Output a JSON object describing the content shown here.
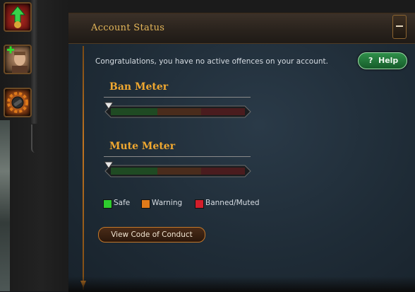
{
  "sidebar": {
    "buttons": [
      {
        "name": "upgrade",
        "icon": "green-arrow-up-icon"
      },
      {
        "name": "add-friend",
        "icon": "add-friend-plus-icon"
      },
      {
        "name": "ignore",
        "icon": "ignore-cog-icon"
      }
    ]
  },
  "panel": {
    "title": "Account Status",
    "message": "Congratulations, you have no active offences on your account.",
    "help_label": "Help",
    "help_icon": "?",
    "collapse_icon": "minus-icon"
  },
  "meters": [
    {
      "label": "Ban Meter",
      "level": 0.0
    },
    {
      "label": "Mute Meter",
      "level": 0.0
    }
  ],
  "legend": [
    {
      "label": "Safe",
      "color": "#2ecc2e"
    },
    {
      "label": "Warning",
      "color": "#e07a1a"
    },
    {
      "label": "Banned/Muted",
      "color": "#d21e2b"
    }
  ],
  "conduct_button": "View Code of Conduct",
  "colors": {
    "accent_gold": "#e5b75a",
    "meter_title": "#f0a830",
    "help_green": "#2f8f4a"
  }
}
